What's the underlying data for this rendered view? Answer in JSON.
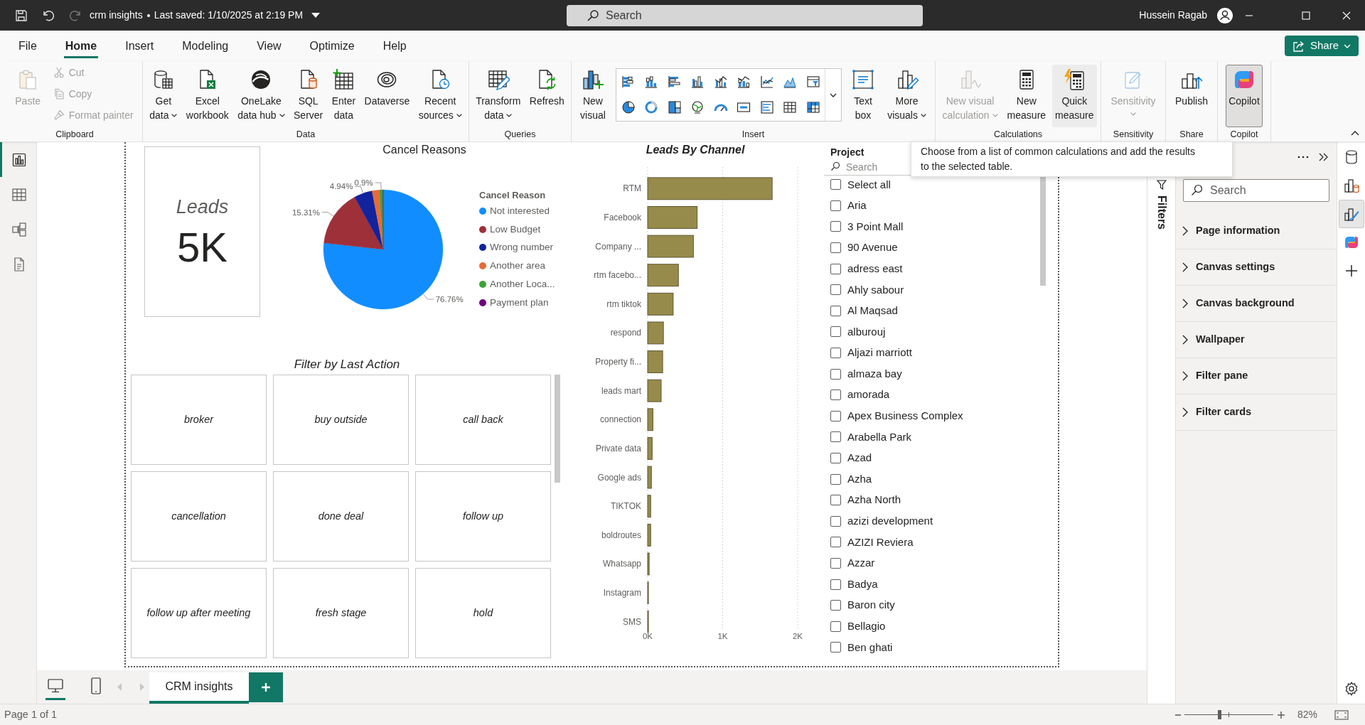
{
  "title_bar": {
    "quick_access": [
      {
        "disabled": false
      },
      {
        "disabled": false
      },
      {
        "disabled": true
      }
    ],
    "document_name": "crm insights",
    "save_status": "Last saved: 1/10/2025 at 2:19 PM",
    "search": {
      "placeholder": "Search"
    },
    "user_name": "Hussein Ragab"
  },
  "ribbon_tabs": [
    {
      "label": "File",
      "selected": false
    },
    {
      "label": "Home",
      "selected": true
    },
    {
      "label": "Insert",
      "selected": false
    },
    {
      "label": "Modeling",
      "selected": false
    },
    {
      "label": "View",
      "selected": false
    },
    {
      "label": "Optimize",
      "selected": false
    },
    {
      "label": "Help",
      "selected": false
    }
  ],
  "share_button": {
    "label": "Share"
  },
  "ribbon_groups": [
    {
      "label": "Clipboard",
      "items": [
        {
          "kind": "large",
          "lines": [
            "Paste"
          ],
          "dropdown": false,
          "disabled": true,
          "hovered": false,
          "pressed": false
        },
        {
          "kind": "small",
          "lines": [
            "Cut"
          ],
          "dropdown": false,
          "disabled": true,
          "hovered": false,
          "pressed": false
        },
        {
          "kind": "small",
          "lines": [
            "Copy"
          ],
          "dropdown": false,
          "disabled": true,
          "hovered": false,
          "pressed": false
        },
        {
          "kind": "small",
          "lines": [
            "Format painter"
          ],
          "dropdown": false,
          "disabled": true,
          "hovered": false,
          "pressed": false
        }
      ]
    },
    {
      "label": "Data",
      "items": [
        {
          "kind": "large",
          "lines": [
            "Get",
            "data"
          ],
          "dropdown": true,
          "disabled": false,
          "hovered": false,
          "pressed": false
        },
        {
          "kind": "large",
          "lines": [
            "Excel",
            "workbook"
          ],
          "dropdown": false,
          "disabled": false,
          "hovered": false,
          "pressed": false
        },
        {
          "kind": "large",
          "lines": [
            "OneLake",
            "data hub"
          ],
          "dropdown": true,
          "disabled": false,
          "hovered": false,
          "pressed": false
        },
        {
          "kind": "large",
          "lines": [
            "SQL",
            "Server"
          ],
          "dropdown": false,
          "disabled": false,
          "hovered": false,
          "pressed": false
        },
        {
          "kind": "large",
          "lines": [
            "Enter",
            "data"
          ],
          "dropdown": false,
          "disabled": false,
          "hovered": false,
          "pressed": false
        },
        {
          "kind": "large",
          "lines": [
            "Dataverse"
          ],
          "dropdown": false,
          "disabled": false,
          "hovered": false,
          "pressed": false
        },
        {
          "kind": "large",
          "lines": [
            "Recent",
            "sources"
          ],
          "dropdown": true,
          "disabled": false,
          "hovered": false,
          "pressed": false
        }
      ]
    },
    {
      "label": "Queries",
      "items": [
        {
          "kind": "large",
          "lines": [
            "Transform",
            "data"
          ],
          "dropdown": true,
          "disabled": false,
          "hovered": false,
          "pressed": false
        },
        {
          "kind": "large",
          "lines": [
            "Refresh"
          ],
          "dropdown": false,
          "disabled": false,
          "hovered": false,
          "pressed": false
        }
      ]
    },
    {
      "label": "Insert",
      "items": [
        {
          "kind": "large",
          "lines": [
            "New",
            "visual"
          ],
          "dropdown": false,
          "disabled": false,
          "hovered": false,
          "pressed": false
        },
        {
          "kind": "gallery"
        },
        {
          "kind": "large",
          "lines": [
            "Text",
            "box"
          ],
          "dropdown": false,
          "disabled": false,
          "hovered": false,
          "pressed": false
        },
        {
          "kind": "large",
          "lines": [
            "More",
            "visuals"
          ],
          "dropdown": true,
          "disabled": false,
          "hovered": false,
          "pressed": false
        }
      ]
    },
    {
      "label": "Calculations",
      "items": [
        {
          "kind": "large",
          "lines": [
            "New visual",
            "calculation"
          ],
          "dropdown": true,
          "disabled": true,
          "hovered": false,
          "pressed": false
        },
        {
          "kind": "large",
          "lines": [
            "New",
            "measure"
          ],
          "dropdown": false,
          "disabled": false,
          "hovered": false,
          "pressed": false
        },
        {
          "kind": "large",
          "lines": [
            "Quick",
            "measure"
          ],
          "dropdown": false,
          "disabled": false,
          "hovered": true,
          "pressed": false
        }
      ]
    },
    {
      "label": "Sensitivity",
      "items": [
        {
          "kind": "large",
          "lines": [
            "Sensitivity"
          ],
          "dropdown": true,
          "disabled": true,
          "hovered": false,
          "pressed": false
        }
      ]
    },
    {
      "label": "Share",
      "items": [
        {
          "kind": "large",
          "lines": [
            "Publish"
          ],
          "dropdown": false,
          "disabled": false,
          "hovered": false,
          "pressed": false
        }
      ]
    },
    {
      "label": "Copilot",
      "items": [
        {
          "kind": "large",
          "lines": [
            "Copilot"
          ],
          "dropdown": false,
          "disabled": false,
          "hovered": false,
          "pressed": true
        }
      ]
    }
  ],
  "tooltip": "Choose from a list of common calculations and add the results to the selected table.",
  "view_switcher": [
    {
      "selected": true
    },
    {
      "selected": false
    },
    {
      "selected": false
    },
    {
      "selected": false
    }
  ],
  "report": {
    "card": {
      "label": "Leads",
      "value": "5K"
    },
    "cancel_reasons": {
      "chart_data": {
        "type": "pie",
        "title": "Cancel Reasons",
        "legend_title": "Cancel Reason",
        "legend": "right",
        "categories": [
          "Not interested",
          "Low Budget",
          "Wrong number",
          "Another area",
          "Another Loca...",
          "Payment plan"
        ],
        "values": [
          76.76,
          15.31,
          4.94,
          1.99,
          0.9,
          0.1
        ],
        "colors": [
          "#118dff",
          "#9e3039",
          "#12239e",
          "#e66c37",
          "#3ba335",
          "#6b007b"
        ],
        "value_labels": [
          "76.76%",
          "15.31%",
          "4.94%",
          null,
          "0.9%",
          null
        ]
      }
    },
    "leads_by_channel": {
      "chart_data": {
        "type": "bar",
        "orientation": "horizontal",
        "title": "Leads By Channel",
        "categories": [
          "RTM",
          "Facebook",
          "Company ...",
          "rtm facebo...",
          "rtm tiktok",
          "respond",
          "Property fi...",
          "leads mart",
          "connection",
          "Private data",
          "Google ads",
          "TIKTOK",
          "boldroutes",
          "Whatsapp",
          "Instagram",
          "SMS"
        ],
        "values": [
          1660,
          660,
          610,
          410,
          340,
          210,
          200,
          180,
          70,
          60,
          50,
          40,
          40,
          20,
          10,
          10
        ],
        "color": "#978b4b",
        "xlim": [
          0,
          2000
        ],
        "xticks": [
          {
            "value": 0,
            "label": "0K"
          },
          {
            "value": 1000,
            "label": "1K"
          },
          {
            "value": 2000,
            "label": "2K"
          }
        ],
        "grid": true
      }
    },
    "project_slicer": {
      "title": "Project",
      "search": {
        "placeholder": "Search"
      },
      "items": [
        {
          "label": "Select all",
          "checked": false
        },
        {
          "label": "Aria",
          "checked": false
        },
        {
          "label": "3 Point Mall",
          "checked": false
        },
        {
          "label": "90 Avenue",
          "checked": false
        },
        {
          "label": "adress east",
          "checked": false
        },
        {
          "label": "Ahly sabour",
          "checked": false
        },
        {
          "label": "Al Maqsad",
          "checked": false
        },
        {
          "label": "alburouj",
          "checked": false
        },
        {
          "label": "Aljazi marriott",
          "checked": false
        },
        {
          "label": "almaza bay",
          "checked": false
        },
        {
          "label": "amorada",
          "checked": false
        },
        {
          "label": "Apex Business Complex",
          "checked": false
        },
        {
          "label": "Arabella Park",
          "checked": false
        },
        {
          "label": "Azad",
          "checked": false
        },
        {
          "label": "Azha",
          "checked": false
        },
        {
          "label": "Azha North",
          "checked": false
        },
        {
          "label": "azizi development",
          "checked": false
        },
        {
          "label": "AZIZI Reviera",
          "checked": false
        },
        {
          "label": "Azzar",
          "checked": false
        },
        {
          "label": "Badya",
          "checked": false
        },
        {
          "label": "Baron city",
          "checked": false
        },
        {
          "label": "Bellagio",
          "checked": false
        },
        {
          "label": "Ben ghati",
          "checked": false
        }
      ]
    },
    "last_action_filter": {
      "title": "Filter by Last Action",
      "tiles": [
        {
          "label": "broker",
          "selected": false
        },
        {
          "label": "buy outside",
          "selected": false
        },
        {
          "label": "call back",
          "selected": false
        },
        {
          "label": "cancellation",
          "selected": false
        },
        {
          "label": "done deal",
          "selected": false
        },
        {
          "label": "follow up",
          "selected": false
        },
        {
          "label": "follow up after meeting",
          "selected": false
        },
        {
          "label": "fresh stage",
          "selected": false
        },
        {
          "label": "hold",
          "selected": false
        }
      ]
    }
  },
  "filters_pane": {
    "label": "Filters"
  },
  "format_pane": {
    "search": {
      "placeholder": "Search"
    },
    "sections": [
      {
        "label": "Page information",
        "expanded": false
      },
      {
        "label": "Canvas settings",
        "expanded": false
      },
      {
        "label": "Canvas background",
        "expanded": false
      },
      {
        "label": "Wallpaper",
        "expanded": false
      },
      {
        "label": "Filter pane",
        "expanded": false
      },
      {
        "label": "Filter cards",
        "expanded": false
      }
    ]
  },
  "pane_switcher": [
    {
      "selected": false
    },
    {
      "selected": false
    },
    {
      "selected": true
    },
    {
      "selected": false
    }
  ],
  "page_bar": {
    "layouts": [
      {
        "selected": true
      },
      {
        "selected": false
      }
    ],
    "pages": [
      {
        "label": "CRM insights",
        "selected": true
      }
    ]
  },
  "status_bar": {
    "page_info": "Page 1 of 1",
    "zoom": {
      "level": 0.39,
      "reading": "82%"
    }
  }
}
